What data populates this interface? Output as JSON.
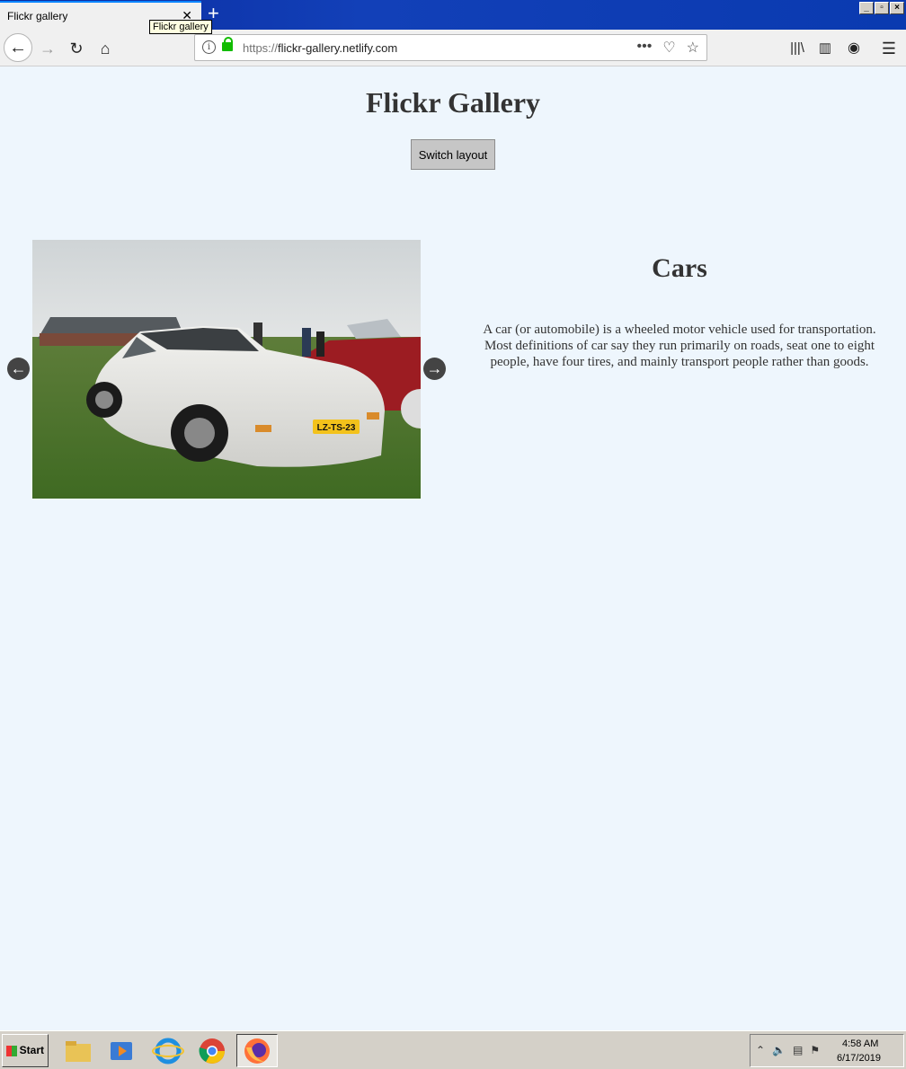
{
  "browser": {
    "tab_title": "Flickr gallery",
    "tooltip": "Flickr gallery",
    "url_protocol": "https://",
    "url_host": "flickr-gallery.netlify.com",
    "page_actions_icon": "more-icon"
  },
  "page": {
    "title": "Flickr Gallery",
    "switch_button": "Switch layout",
    "prev_arrow": "←",
    "next_arrow": "→",
    "detail_title": "Cars",
    "detail_description": "A car (or automobile) is a wheeled motor vehicle used for transportation. Most definitions of car say they run primarily on roads, seat one to eight people, have four tires, and mainly transport people rather than goods.",
    "photo_plate": "LZ-TS-23"
  },
  "taskbar": {
    "start_label": "Start",
    "clock_time": "4:58 AM",
    "clock_date": "6/17/2019"
  },
  "colors": {
    "page_background": "#eef6fd",
    "title_text": "#333333",
    "button_gray": "#c6c6c6",
    "arrow_bg": "#444444",
    "titlebar_blue": "#0a2a9e"
  }
}
